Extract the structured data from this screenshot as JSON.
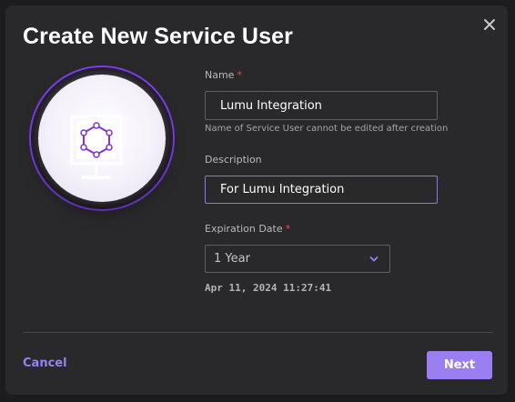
{
  "dialog": {
    "title": "Create New Service User",
    "close_icon": "close-icon"
  },
  "illustration": {
    "icon": "monitor-network-icon"
  },
  "form": {
    "name": {
      "label": "Name",
      "required_mark": "*",
      "value": "Lumu Integration",
      "hint": "Name of Service User cannot be edited after creation"
    },
    "description": {
      "label": "Description",
      "value": "For Lumu Integration"
    },
    "expiration": {
      "label": "Expiration Date",
      "required_mark": "*",
      "selected": "1 Year",
      "chevron_icon": "chevron-down-icon",
      "date": "Apr 11, 2024 11:27:41"
    }
  },
  "footer": {
    "cancel_label": "Cancel",
    "next_label": "Next"
  },
  "colors": {
    "background": "#29292b",
    "accent": "#9b7ff2",
    "required": "#e34b58",
    "illustration_ring": "#7c3aed"
  }
}
